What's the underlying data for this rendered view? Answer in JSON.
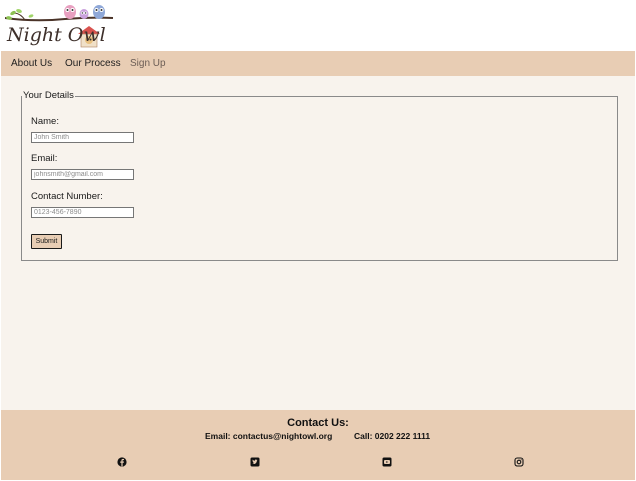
{
  "brand": {
    "logo_text": "Night Owl"
  },
  "nav": {
    "items": [
      {
        "label": "About Us"
      },
      {
        "label": "Our Process"
      },
      {
        "label": "Sign Up"
      }
    ]
  },
  "form": {
    "legend": "Your Details",
    "name_label": "Name:",
    "name_placeholder": "John Smith",
    "email_label": "Email:",
    "email_placeholder": "johnsmith@gmail.com",
    "phone_label": "Contact Number:",
    "phone_placeholder": "0123-456-7890",
    "submit_label": "Submit"
  },
  "footer": {
    "title": "Contact Us:",
    "email": "Email: contactus@nightowl.org",
    "phone": "Call: 0202 222 1111",
    "social": [
      "facebook-icon",
      "twitter-icon",
      "youtube-icon",
      "instagram-icon"
    ]
  },
  "colors": {
    "accent": "#e8cdb4",
    "background": "#f8f3ed"
  }
}
